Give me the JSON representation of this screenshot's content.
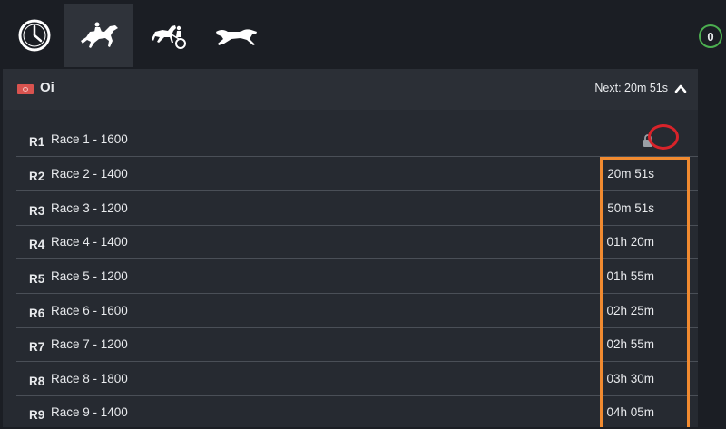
{
  "nav": {
    "tabs": [
      {
        "name": "clock-icon",
        "active": false
      },
      {
        "name": "horse-racing-icon",
        "active": true
      },
      {
        "name": "harness-racing-icon",
        "active": false
      },
      {
        "name": "greyhound-racing-icon",
        "active": false
      }
    ],
    "badge_count": "0"
  },
  "meeting": {
    "name": "Oi",
    "next_label": "Next: 20m 51s",
    "flag_color": "#d9534f"
  },
  "races": [
    {
      "num": "R1",
      "name": "Race 1 - 1600",
      "time": "",
      "status": "locked"
    },
    {
      "num": "R2",
      "name": "Race 2 - 1400",
      "time": "20m 51s"
    },
    {
      "num": "R3",
      "name": "Race 3 - 1200",
      "time": "50m 51s"
    },
    {
      "num": "R4",
      "name": "Race 4 - 1400",
      "time": "01h 20m"
    },
    {
      "num": "R5",
      "name": "Race 5 - 1200",
      "time": "01h 55m"
    },
    {
      "num": "R6",
      "name": "Race 6 - 1600",
      "time": "02h 25m"
    },
    {
      "num": "R7",
      "name": "Race 7 - 1200",
      "time": "02h 55m"
    },
    {
      "num": "R8",
      "name": "Race 8 - 1800",
      "time": "03h 30m"
    },
    {
      "num": "R9",
      "name": "Race 9 - 1400",
      "time": "04h 05m"
    }
  ],
  "annotations": {
    "lock_highlight_color": "#d8232a",
    "times_highlight_color": "#f08a30"
  },
  "colors": {
    "background": "#1b1e24",
    "panel": "#262a31",
    "active_tab": "#2f333a",
    "badge_border": "#4caf50"
  }
}
